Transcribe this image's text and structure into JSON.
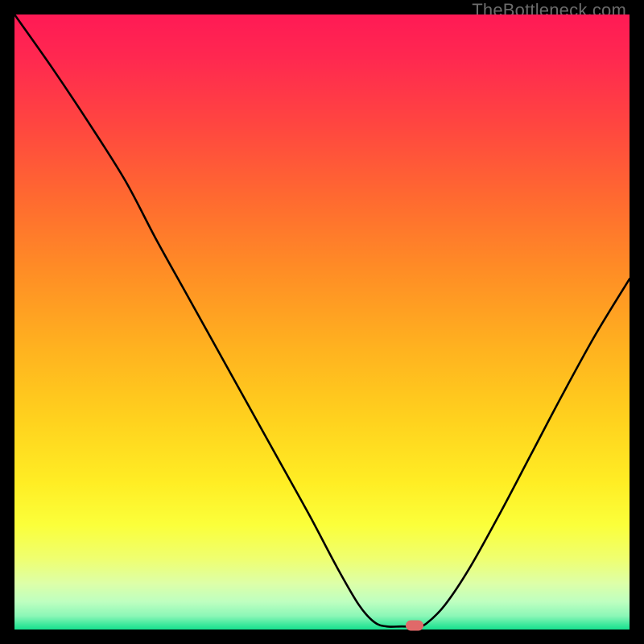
{
  "watermark": "TheBottleneck.com",
  "chart_data": {
    "type": "line",
    "title": "",
    "xlabel": "",
    "ylabel": "",
    "x_range": [
      0,
      100
    ],
    "y_range": [
      0,
      100
    ],
    "curve": [
      {
        "x": 0.0,
        "y": 100.0
      },
      {
        "x": 6.0,
        "y": 91.5
      },
      {
        "x": 12.0,
        "y": 82.5
      },
      {
        "x": 18.0,
        "y": 73.0
      },
      {
        "x": 23.0,
        "y": 63.5
      },
      {
        "x": 28.0,
        "y": 54.5
      },
      {
        "x": 33.0,
        "y": 45.5
      },
      {
        "x": 38.0,
        "y": 36.5
      },
      {
        "x": 43.0,
        "y": 27.5
      },
      {
        "x": 48.0,
        "y": 18.5
      },
      {
        "x": 52.5,
        "y": 10.0
      },
      {
        "x": 56.0,
        "y": 4.0
      },
      {
        "x": 58.5,
        "y": 1.2
      },
      {
        "x": 60.5,
        "y": 0.5
      },
      {
        "x": 63.0,
        "y": 0.5
      },
      {
        "x": 65.5,
        "y": 0.5
      },
      {
        "x": 67.0,
        "y": 1.0
      },
      {
        "x": 70.0,
        "y": 4.0
      },
      {
        "x": 74.0,
        "y": 10.0
      },
      {
        "x": 79.0,
        "y": 19.0
      },
      {
        "x": 84.0,
        "y": 28.5
      },
      {
        "x": 89.0,
        "y": 38.0
      },
      {
        "x": 94.5,
        "y": 48.0
      },
      {
        "x": 100.0,
        "y": 57.0
      }
    ],
    "marker": {
      "x": 65.0,
      "y": 0.6,
      "color": "#e06969"
    },
    "gradient_stops": [
      {
        "offset": 0.0,
        "color": "#ff1a55"
      },
      {
        "offset": 0.07,
        "color": "#ff2850"
      },
      {
        "offset": 0.18,
        "color": "#ff4640"
      },
      {
        "offset": 0.3,
        "color": "#ff6a30"
      },
      {
        "offset": 0.42,
        "color": "#ff8e25"
      },
      {
        "offset": 0.55,
        "color": "#ffb41f"
      },
      {
        "offset": 0.66,
        "color": "#ffd21e"
      },
      {
        "offset": 0.76,
        "color": "#ffed24"
      },
      {
        "offset": 0.83,
        "color": "#fbff3a"
      },
      {
        "offset": 0.885,
        "color": "#efff70"
      },
      {
        "offset": 0.925,
        "color": "#ddffa8"
      },
      {
        "offset": 0.955,
        "color": "#beffc0"
      },
      {
        "offset": 0.978,
        "color": "#8bf7b7"
      },
      {
        "offset": 0.992,
        "color": "#3de89c"
      },
      {
        "offset": 1.0,
        "color": "#18e08f"
      }
    ]
  }
}
